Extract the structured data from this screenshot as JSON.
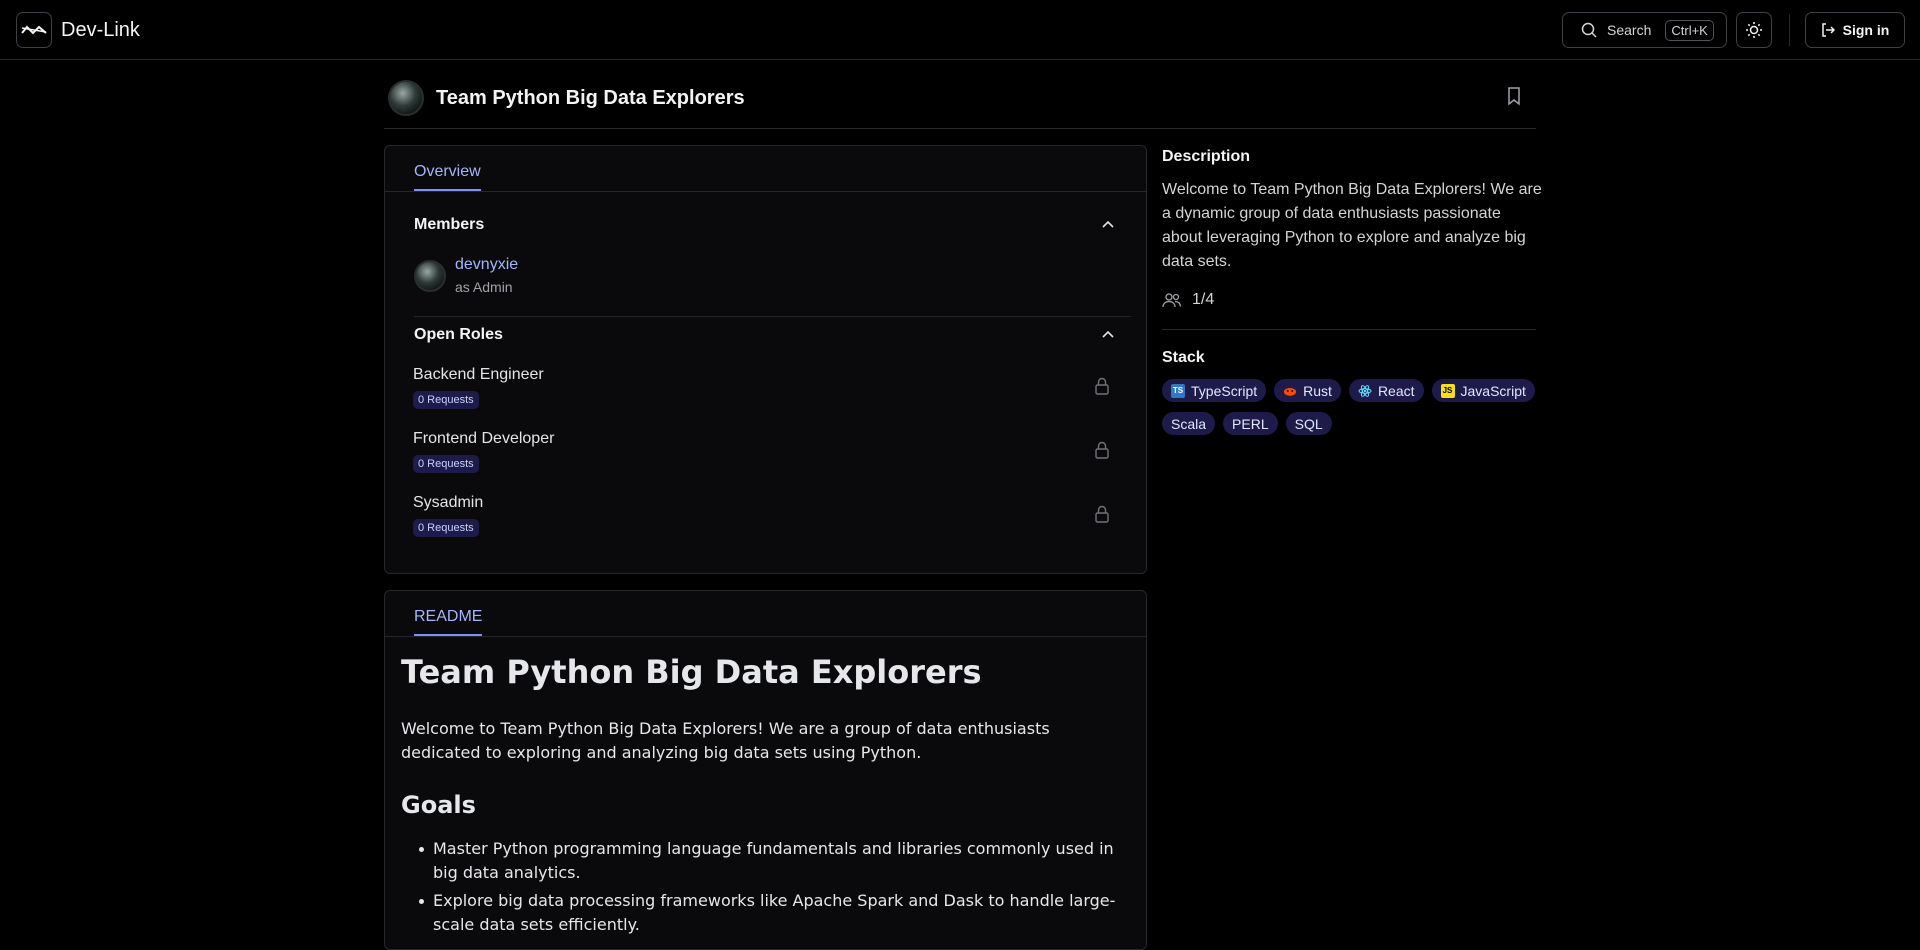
{
  "header": {
    "brand": "Dev-Link",
    "search_label": "Search",
    "search_shortcut": "Ctrl+K",
    "signin_label": "Sign in"
  },
  "team": {
    "title": "Team Python Big Data Explorers"
  },
  "overview": {
    "tab_label": "Overview",
    "members_title": "Members",
    "members": [
      {
        "name": "devnyxie",
        "role": "as Admin"
      }
    ],
    "open_roles_title": "Open Roles",
    "roles": [
      {
        "name": "Backend Engineer",
        "requests": "0 Requests"
      },
      {
        "name": "Frontend Developer",
        "requests": "0 Requests"
      },
      {
        "name": "Sysadmin",
        "requests": "0 Requests"
      }
    ]
  },
  "sidebar": {
    "description_title": "Description",
    "description": "Welcome to Team Python Big Data Explorers! We are a dynamic group of data enthusiasts passionate about leveraging Python to explore and analyze big data sets.",
    "member_count": "1/4",
    "stack_title": "Stack",
    "stack": [
      {
        "label": "TypeScript",
        "icon": "typescript-icon",
        "color": "#3178c6"
      },
      {
        "label": "Rust",
        "icon": "rust-icon",
        "color": "#f74c00"
      },
      {
        "label": "React",
        "icon": "react-icon",
        "color": "#61dafb"
      },
      {
        "label": "JavaScript",
        "icon": "javascript-icon",
        "color": "#f7df1e"
      },
      {
        "label": "Scala"
      },
      {
        "label": "PERL"
      },
      {
        "label": "SQL"
      }
    ]
  },
  "readme": {
    "tab_label": "README",
    "h1": "Team Python Big Data Explorers",
    "intro": "Welcome to Team Python Big Data Explorers! We are a group of data enthusiasts dedicated to exploring and analyzing big data sets using Python.",
    "goals_title": "Goals",
    "goals": [
      "Master Python programming language fundamentals and libraries commonly used in big data analytics.",
      "Explore big data processing frameworks like Apache Spark and Dask to handle large-scale data sets efficiently."
    ]
  },
  "colors": {
    "accent": "#a5b4fc",
    "chip_bg": "#1e1b4b",
    "background": "#000000"
  }
}
